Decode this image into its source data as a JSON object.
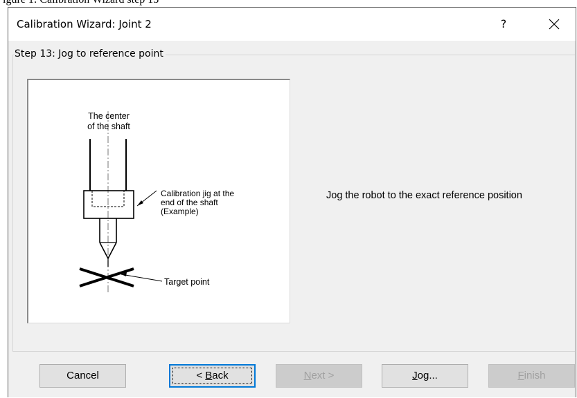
{
  "caption_fragment": "igure 1: Calibration Wizard step 13",
  "dialog": {
    "title": "Calibration Wizard: Joint 2",
    "help_label": "?",
    "step_group_label": "Step 13: Jog to reference point",
    "instruction": "Jog the robot to the exact reference position"
  },
  "figure": {
    "label_center_line1": "The center",
    "label_center_line2": "of the shaft",
    "label_jig_line1": "Calibration jig at the",
    "label_jig_line2": "end of the shaft",
    "label_jig_line3": "(Example)",
    "label_target": "Target point"
  },
  "buttons": {
    "cancel": {
      "label": "Cancel",
      "enabled": true
    },
    "back": {
      "prefix": "< ",
      "mnemonic": "B",
      "rest": "ack",
      "enabled": true,
      "default": true
    },
    "next": {
      "mnemonic": "N",
      "rest": "ext >",
      "enabled": false
    },
    "jog": {
      "mnemonic": "J",
      "rest": "og...",
      "enabled": true
    },
    "finish": {
      "mnemonic": "F",
      "rest": "inish",
      "enabled": false
    }
  },
  "icons": {
    "close": "close-icon",
    "help": "help-icon"
  },
  "colors": {
    "dialog_bg": "#f0f0f0",
    "titlebar_bg": "#ffffff",
    "default_button_border": "#0078d7",
    "disabled_text": "#a0a0a0"
  }
}
